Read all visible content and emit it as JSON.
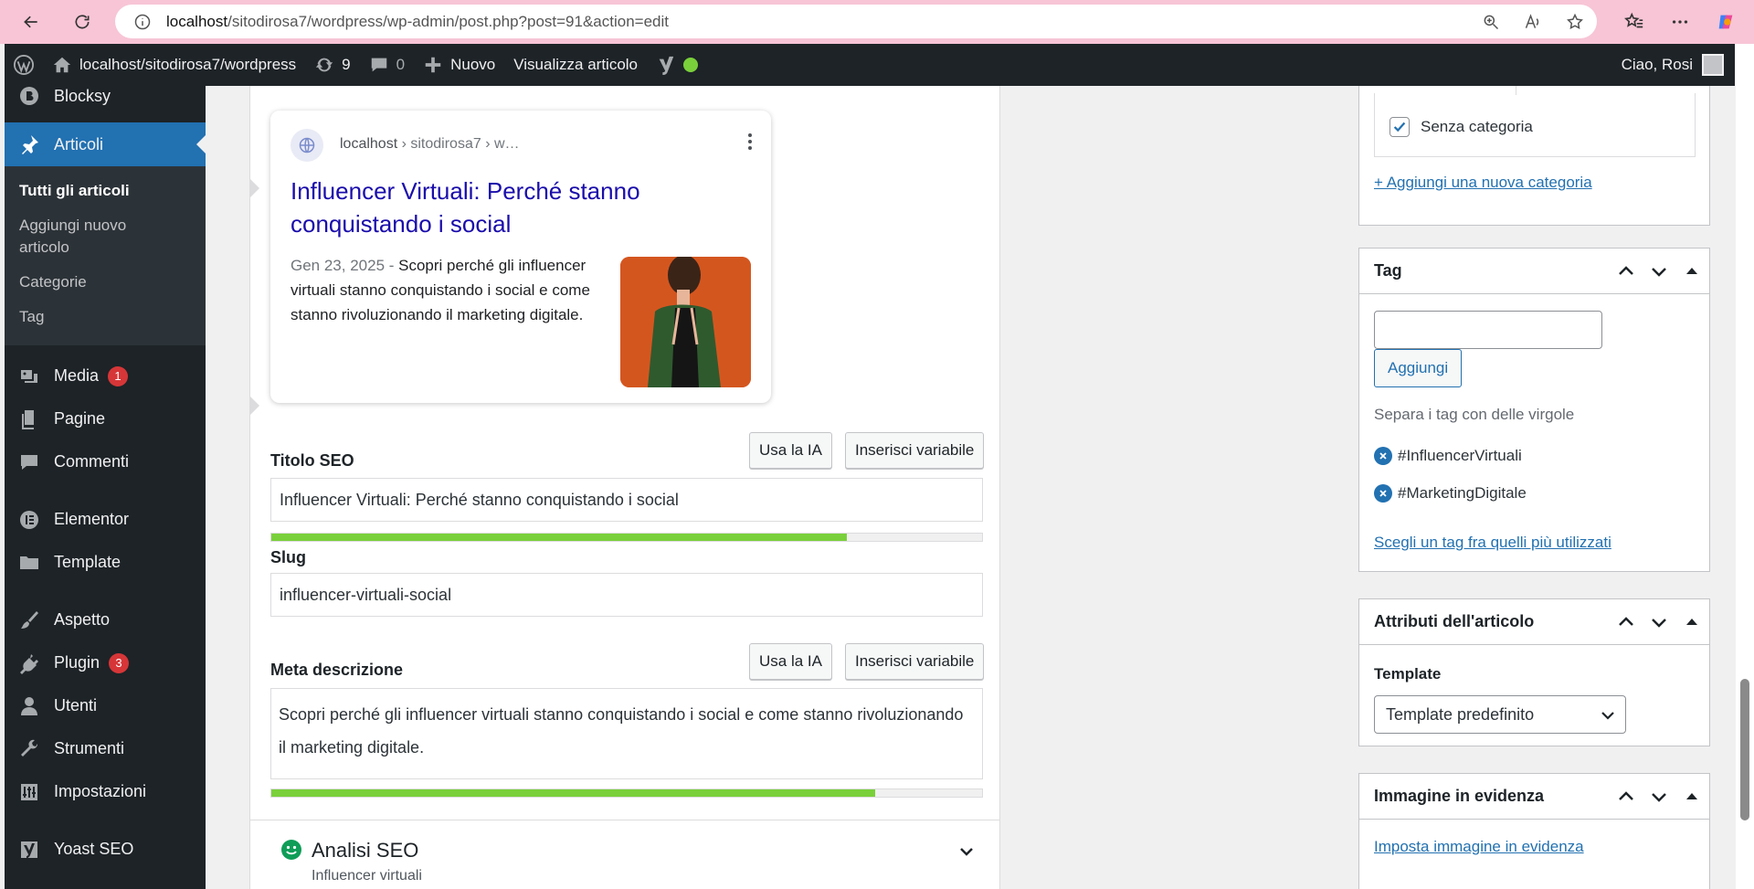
{
  "browser": {
    "url_host": "localhost",
    "url_path": "/sitodirosa7/wordpress/wp-admin/post.php?post=91&action=edit"
  },
  "adminbar": {
    "site_name": "localhost/sitodirosa7/wordpress",
    "updates_count": "9",
    "comments_count": "0",
    "new_label": "Nuovo",
    "view_label": "Visualizza articolo",
    "greeting": "Ciao, Rosi"
  },
  "sidebar": {
    "blocksy": "Blocksy",
    "articoli": "Articoli",
    "submenu": [
      "Tutti gli articoli",
      "Aggiungi nuovo articolo",
      "Categorie",
      "Tag"
    ],
    "media": "Media",
    "media_badge": "1",
    "pagine": "Pagine",
    "commenti": "Commenti",
    "elementor": "Elementor",
    "template": "Template",
    "aspetto": "Aspetto",
    "plugin": "Plugin",
    "plugin_badge": "3",
    "utenti": "Utenti",
    "strumenti": "Strumenti",
    "impostazioni": "Impostazioni",
    "yoast": "Yoast SEO"
  },
  "serp": {
    "url_host": "localhost",
    "url_rest": " › sitodirosa7 › w…",
    "title": "Influencer Virtuali: Perché stanno conquistando i social",
    "date": "Gen 23, 2025",
    "separator": " - ",
    "snippet": "Scopri perché gli influencer virtuali stanno conquistando i social e come stanno rivoluzionando il marketing digitale."
  },
  "seo_title": {
    "label": "Titolo SEO",
    "ai_button": "Usa la IA",
    "var_button": "Inserisci variabile",
    "value": "Influencer Virtuali: Perché stanno conquistando i social",
    "progress": 0.81
  },
  "slug": {
    "label": "Slug",
    "value": "influencer-virtuali-social"
  },
  "meta": {
    "label": "Meta descrizione",
    "ai_button": "Usa la IA",
    "var_button": "Inserisci variabile",
    "value": "Scopri perché gli influencer virtuali stanno conquistando i social e come stanno rivoluzionando il marketing digitale.",
    "progress": 0.85
  },
  "seo_analysis": {
    "title": "Analisi SEO",
    "keyphrase": "Influencer virtuali"
  },
  "categories_box": {
    "checked_category": "Senza categoria",
    "add_link": "+ Aggiungi una nuova categoria"
  },
  "tags_box": {
    "title": "Tag",
    "input_value": "",
    "add_button": "Aggiungi",
    "hint": "Separa i tag con delle virgole",
    "tags": [
      "#InfluencerVirtuali",
      "#MarketingDigitale"
    ],
    "choose_link": "Scegli un tag fra quelli più utilizzati"
  },
  "attributes_box": {
    "title": "Attributi dell'articolo",
    "template_label": "Template",
    "template_value": "Template predefinito"
  },
  "featured_box": {
    "title": "Immagine in evidenza",
    "set_link": "Imposta immagine in evidenza"
  },
  "colors": {
    "admin_dark": "#1d2327",
    "accent_blue": "#2271b1",
    "progress_green": "#7ad03a",
    "browser_pink": "#f7c5d6",
    "badge_red": "#d63638"
  }
}
